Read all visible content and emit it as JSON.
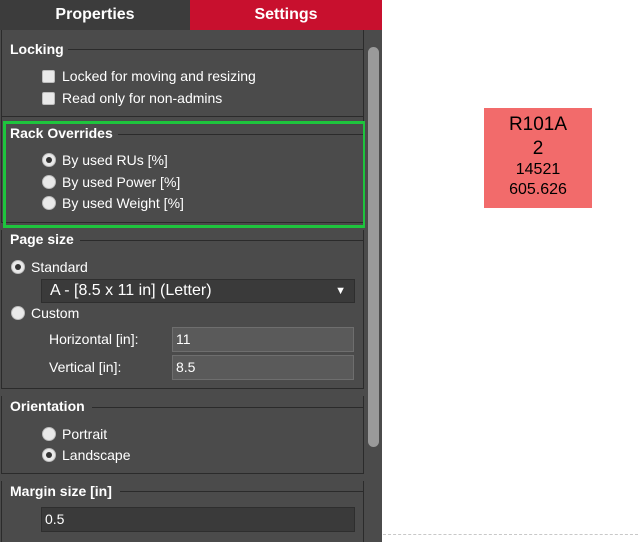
{
  "tabs": {
    "properties": "Properties",
    "settings": "Settings"
  },
  "locking": {
    "title": "Locking",
    "options": [
      {
        "label": "Locked for moving and resizing",
        "checked": false
      },
      {
        "label": "Read only for non-admins",
        "checked": false
      }
    ]
  },
  "rack_overrides": {
    "title": "Rack Overrides",
    "options": [
      {
        "label": "By used RUs [%]",
        "selected": true
      },
      {
        "label": "By used Power [%]",
        "selected": false
      },
      {
        "label": "By used Weight [%]",
        "selected": false
      }
    ]
  },
  "page_size": {
    "title": "Page size",
    "standard_label": "Standard",
    "standard_selected": true,
    "standard_value": "A - [8.5 x 11 in] (Letter)",
    "custom_label": "Custom",
    "custom_selected": false,
    "horizontal_label": "Horizontal [in]:",
    "horizontal_value": "11",
    "vertical_label": "Vertical [in]:",
    "vertical_value": "8.5"
  },
  "orientation": {
    "title": "Orientation",
    "options": [
      {
        "label": "Portrait",
        "selected": false
      },
      {
        "label": "Landscape",
        "selected": true
      }
    ]
  },
  "margin_size": {
    "title": "Margin size [in]",
    "value": "0.5"
  },
  "canvas": {
    "rack": {
      "name": "R101A",
      "line2": "2",
      "line3": "14521",
      "line4": "605.626"
    }
  },
  "colors": {
    "settings_tab": "#c8102e",
    "highlight": "#1ec53d",
    "rack_fill": "#f26b6b",
    "panel_bg": "#4b4b4b"
  }
}
